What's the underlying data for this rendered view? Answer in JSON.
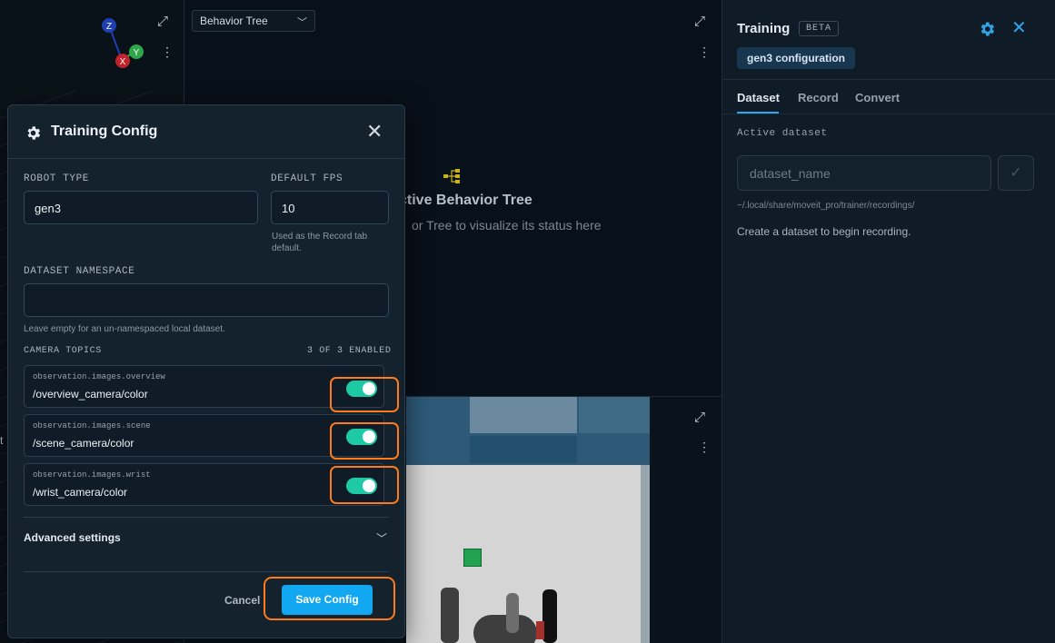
{
  "viewport": {
    "axes": {
      "z": "Z",
      "y": "Y",
      "x": "X"
    },
    "colors": {
      "z": "#1f3fb0",
      "y": "#2ea64a",
      "x": "#c0232b"
    },
    "edge_letter": "t"
  },
  "behavior_tree": {
    "select_value": "Behavior Tree",
    "empty_title": "ctive Behavior Tree",
    "empty_subtitle": "or Tree to visualize its status here",
    "icon_color": "#c9b21a"
  },
  "training_panel": {
    "title": "Training",
    "beta_badge": "BETA",
    "config_chip": "gen3 configuration",
    "tabs": [
      "Dataset",
      "Record",
      "Convert"
    ],
    "active_tab": "Dataset",
    "active_dataset_label": "Active dataset",
    "dataset_placeholder": "dataset_name",
    "path_hint": "~/.local/share/moveit_pro/trainer/recordings/",
    "empty_hint": "Create a dataset to begin recording.",
    "accent": "#2fa6e8"
  },
  "modal": {
    "title": "Training Config",
    "robot_type_label": "ROBOT TYPE",
    "robot_type_value": "gen3",
    "default_fps_label": "DEFAULT FPS",
    "default_fps_value": "10",
    "fps_help": "Used as the Record tab default.",
    "dataset_namespace_label": "DATASET NAMESPACE",
    "dataset_namespace_value": "",
    "namespace_help": "Leave empty for an un-namespaced local dataset.",
    "camera_topics_label": "CAMERA TOPICS",
    "camera_enabled_count": "3 OF 3 ENABLED",
    "cameras": [
      {
        "key": "observation.images.overview",
        "topic": "/overview_camera/color",
        "enabled": true
      },
      {
        "key": "observation.images.scene",
        "topic": "/scene_camera/color",
        "enabled": true
      },
      {
        "key": "observation.images.wrist",
        "topic": "/wrist_camera/color",
        "enabled": true
      }
    ],
    "advanced_label": "Advanced settings",
    "cancel_label": "Cancel",
    "save_label": "Save Config",
    "toggle_color": "#1ec9a6",
    "save_color": "#12a7f1",
    "highlight_color": "#ff7a1a"
  }
}
